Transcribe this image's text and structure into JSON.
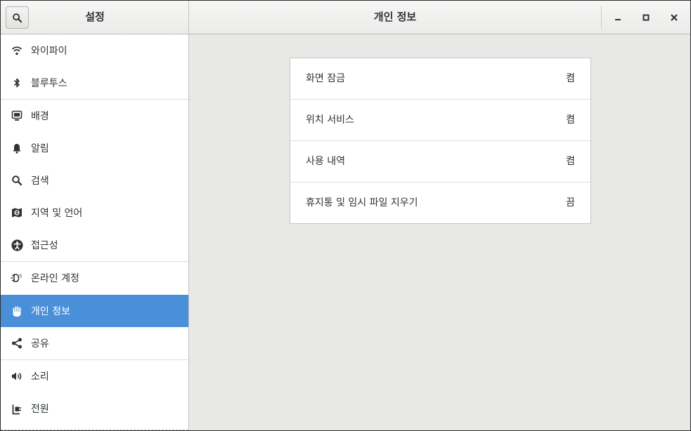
{
  "titlebar": {
    "app_title": "설정",
    "panel_title": "개인 정보",
    "search_icon": "search-icon",
    "minimize_icon": "minimize-icon",
    "maximize_icon": "maximize-icon",
    "close_icon": "close-icon"
  },
  "sidebar": {
    "items": [
      {
        "label": "와이파이",
        "icon": "wifi-icon"
      },
      {
        "label": "블루투스",
        "icon": "bluetooth-icon"
      },
      {
        "label": "배경",
        "icon": "background-icon"
      },
      {
        "label": "알림",
        "icon": "bell-icon"
      },
      {
        "label": "검색",
        "icon": "search-icon"
      },
      {
        "label": "지역 및 언어",
        "icon": "region-icon"
      },
      {
        "label": "접근성",
        "icon": "accessibility-icon"
      },
      {
        "label": "온라인 계정",
        "icon": "online-accounts-icon"
      },
      {
        "label": "개인 정보",
        "icon": "privacy-hand-icon"
      },
      {
        "label": "공유",
        "icon": "share-icon"
      },
      {
        "label": "소리",
        "icon": "speaker-icon"
      },
      {
        "label": "전원",
        "icon": "power-icon"
      }
    ],
    "selected_index": 8
  },
  "privacy": {
    "rows": [
      {
        "label": "화면 잠금",
        "value": "켬"
      },
      {
        "label": "위치 서비스",
        "value": "켬"
      },
      {
        "label": "사용 내역",
        "value": "켬"
      },
      {
        "label": "휴지통 및 임시 파일 지우기",
        "value": "끔"
      }
    ]
  },
  "colors": {
    "accent": "#4a90d9",
    "sidebar_bg": "#ffffff",
    "content_bg": "#e8e8e7",
    "text": "#2e3436"
  }
}
